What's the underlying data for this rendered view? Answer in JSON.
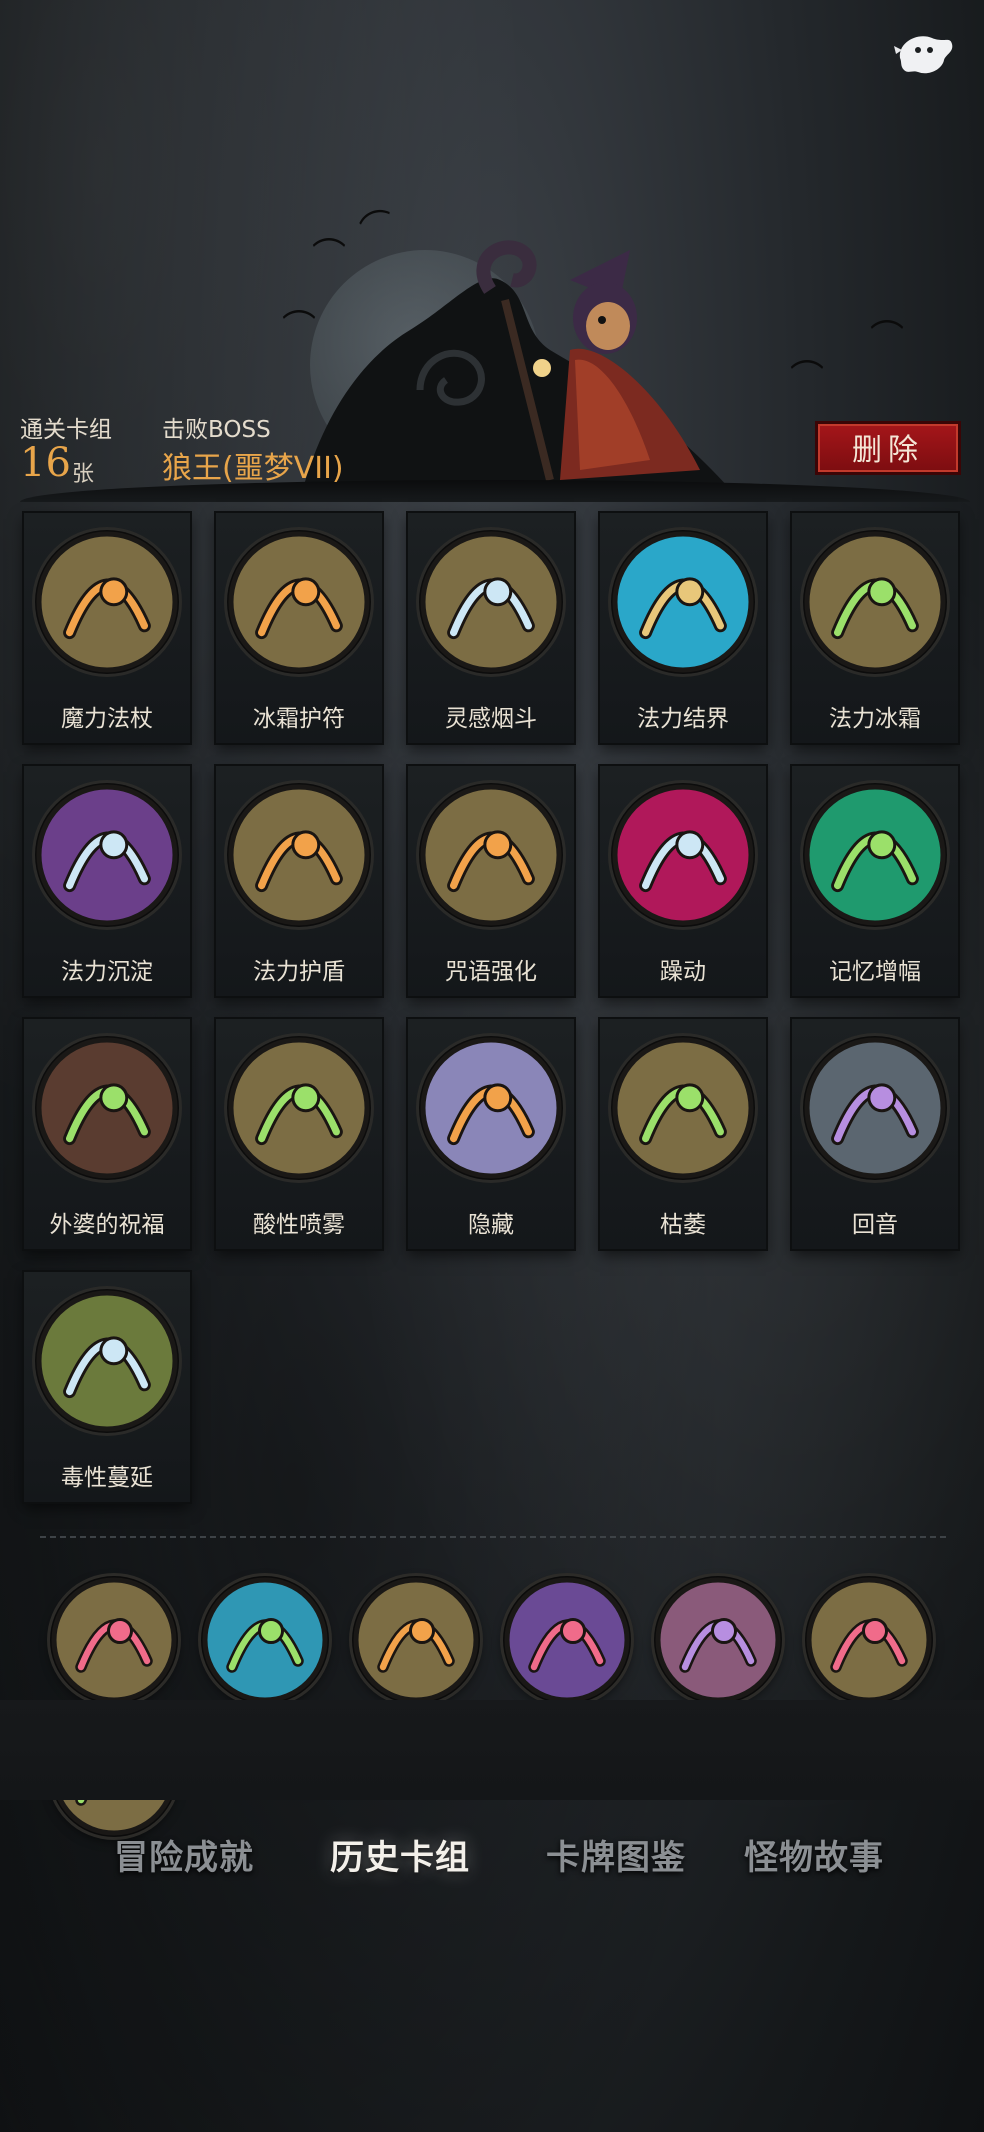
{
  "header": {
    "cleared_deck_label": "通关卡组",
    "cleared_deck_count": "16",
    "cleared_deck_unit": "张",
    "defeated_boss_label": "击败BOSS",
    "defeated_boss_name": "狼王(噩梦VII)",
    "delete_button": "删除"
  },
  "cards": [
    {
      "name": "魔力法杖",
      "icon": "staff-icon",
      "color": "#7c6d44"
    },
    {
      "name": "冰霜护符",
      "icon": "frost-amulet-icon",
      "color": "#7c6d44"
    },
    {
      "name": "灵感烟斗",
      "icon": "pipe-icon",
      "color": "#7c6d44"
    },
    {
      "name": "法力结界",
      "icon": "mana-barrier-icon",
      "color": "#2aa7c9"
    },
    {
      "name": "法力冰霜",
      "icon": "mana-frost-icon",
      "color": "#7c6d44"
    },
    {
      "name": "法力沉淀",
      "icon": "mana-sediment-icon",
      "color": "#6b3f8a"
    },
    {
      "name": "法力护盾",
      "icon": "mana-shield-icon",
      "color": "#7c6d44"
    },
    {
      "name": "咒语强化",
      "icon": "spell-boost-icon",
      "color": "#7c6d44"
    },
    {
      "name": "躁动",
      "icon": "restless-icon",
      "color": "#b0185a"
    },
    {
      "name": "记忆增幅",
      "icon": "memory-amp-icon",
      "color": "#1f9a6e"
    },
    {
      "name": "外婆的祝福",
      "icon": "grandma-blessing-icon",
      "color": "#5a3c30"
    },
    {
      "name": "酸性喷雾",
      "icon": "acid-spray-icon",
      "color": "#7c6d44"
    },
    {
      "name": "隐藏",
      "icon": "hide-icon",
      "color": "#8a86b8"
    },
    {
      "name": "枯萎",
      "icon": "wither-icon",
      "color": "#7c6d44"
    },
    {
      "name": "回音",
      "icon": "echo-icon",
      "color": "#5b6670"
    },
    {
      "name": "毒性蔓延",
      "icon": "toxic-spread-icon",
      "color": "#6b7a3c"
    }
  ],
  "relics": [
    {
      "icon": "spellbook-relic-icon",
      "color": "#7c6d44"
    },
    {
      "icon": "ice-cave-relic-icon",
      "color": "#2f97b4"
    },
    {
      "icon": "card-pack-relic-icon",
      "color": "#7c6d44"
    },
    {
      "icon": "dragon-relic-icon",
      "color": "#6a4a95"
    },
    {
      "icon": "gargoyle-relic-icon",
      "color": "#8a5a7a"
    },
    {
      "icon": "pirate-relic-icon",
      "color": "#7c6d44"
    },
    {
      "icon": "skull-card-relic-icon",
      "color": "#7c6d44"
    }
  ],
  "tabs": [
    {
      "label": "冒险成就",
      "active": false
    },
    {
      "label": "历史卡组",
      "active": true
    },
    {
      "label": "卡牌图鉴",
      "active": false
    },
    {
      "label": "怪物故事",
      "active": false
    }
  ]
}
